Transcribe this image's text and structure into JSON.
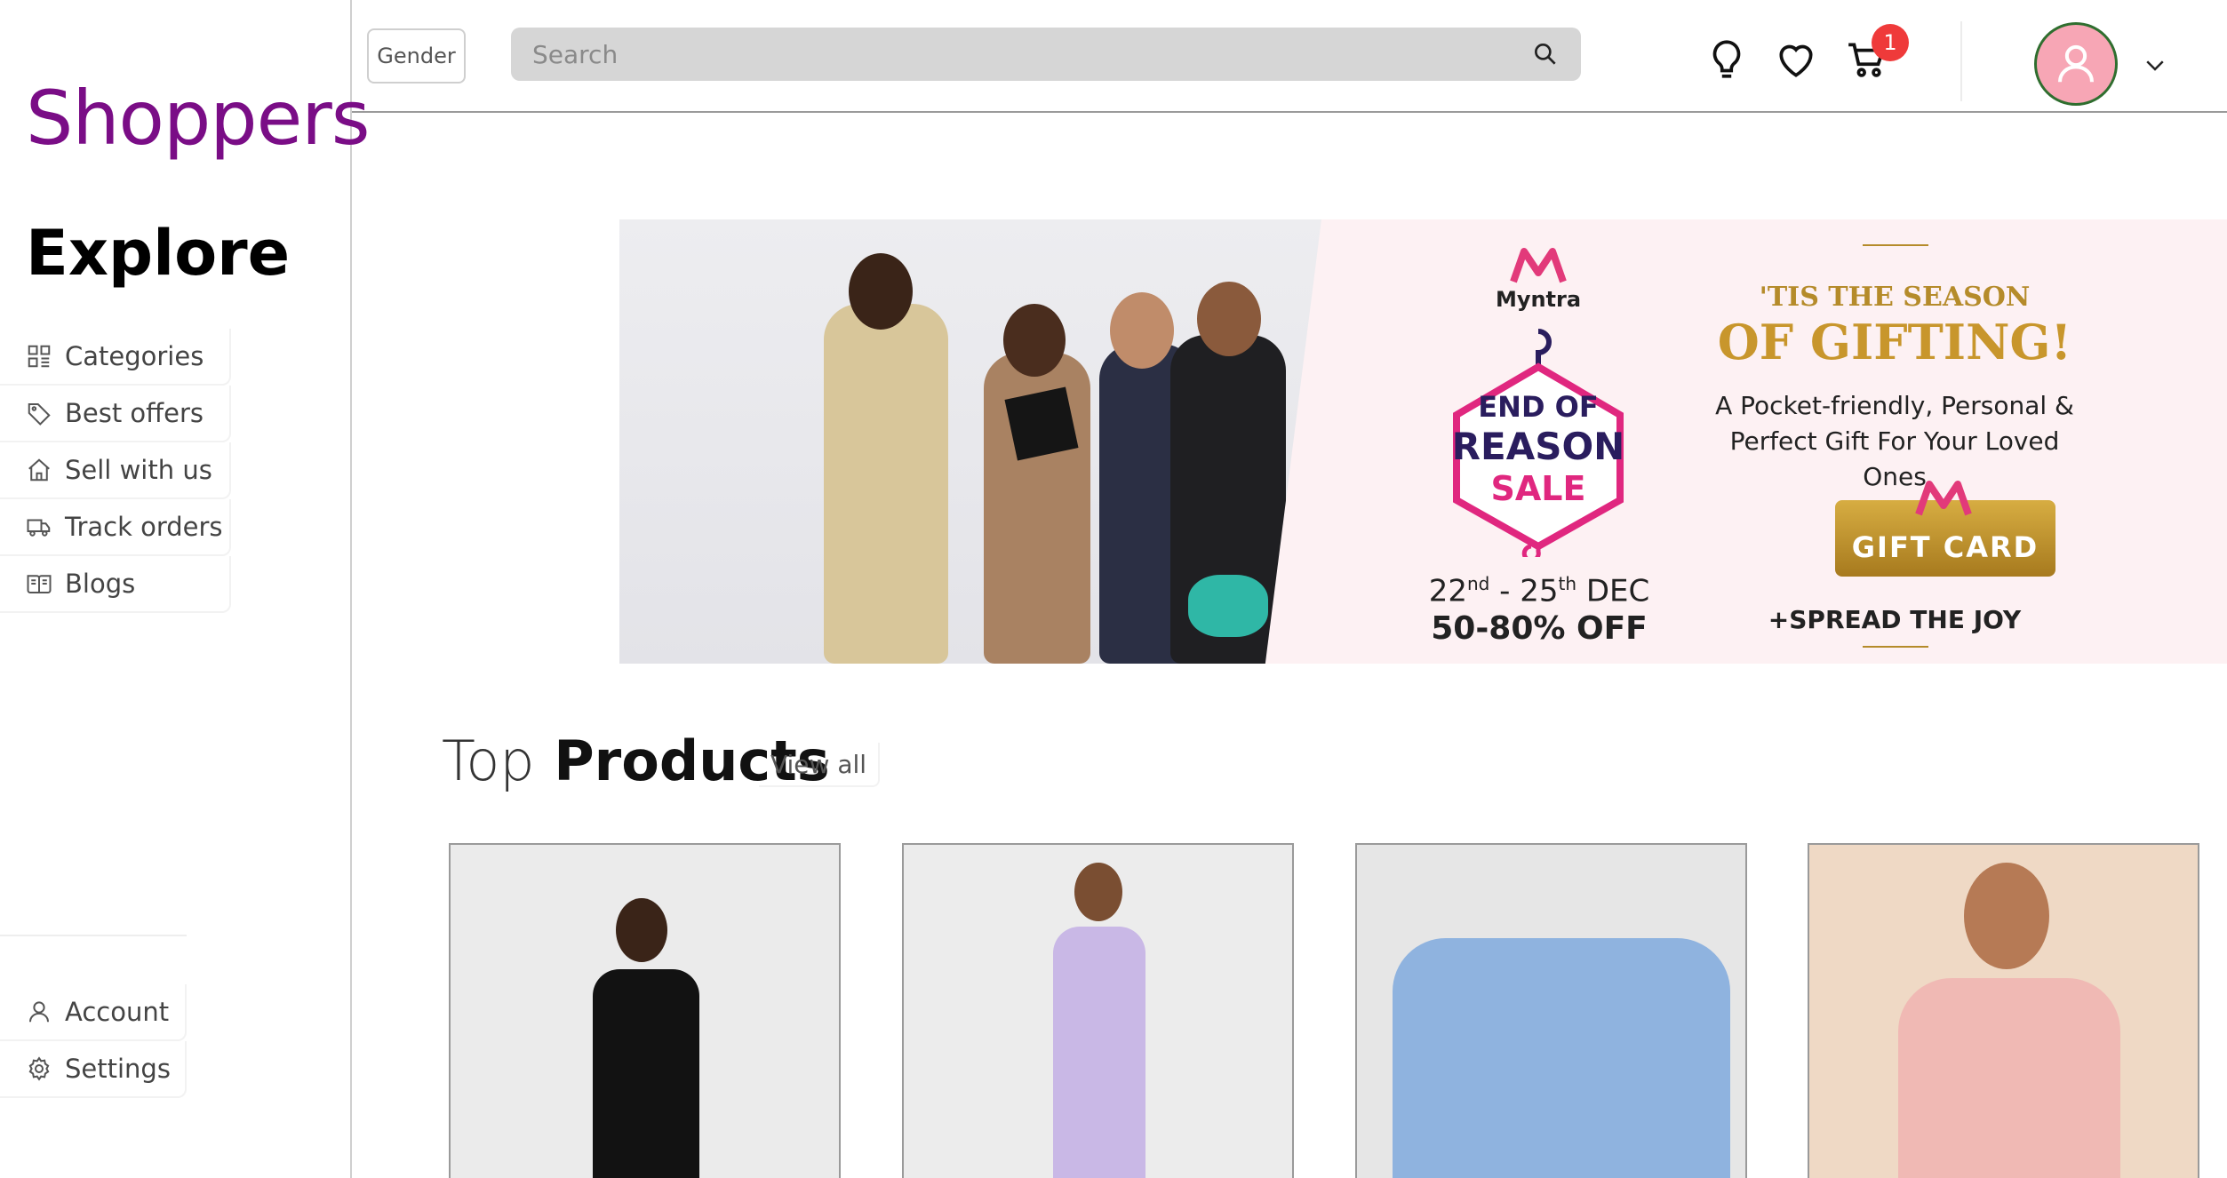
{
  "sidebar": {
    "brand": "Shoppers",
    "heading": "Explore",
    "items": [
      {
        "label": "Categories",
        "icon": "grid-icon"
      },
      {
        "label": "Best offers",
        "icon": "tag-icon"
      },
      {
        "label": "Sell with us",
        "icon": "home-icon"
      },
      {
        "label": "Track orders",
        "icon": "truck-icon"
      },
      {
        "label": "Blogs",
        "icon": "book-icon"
      }
    ],
    "bottom_items": [
      {
        "label": "Account",
        "icon": "user-icon"
      },
      {
        "label": "Settings",
        "icon": "gear-icon"
      }
    ]
  },
  "topbar": {
    "gender_label": "Gender",
    "search_placeholder": "Search",
    "cart_count": "1"
  },
  "banner": {
    "brand": "Myntra",
    "sale_line1": "END OF",
    "sale_line2": "REASON",
    "sale_line3": "SALE",
    "date_start": "22",
    "date_start_sup": "nd",
    "date_sep": " - 25",
    "date_end_sup": "th",
    "date_month": " DEC",
    "discount": "50-80% OFF",
    "tagline_small": "'TIS THE SEASON",
    "tagline_big": "OF GIFTING!",
    "desc_line1": "A Pocket-friendly, Personal &",
    "desc_line2": "Perfect Gift For Your Loved Ones",
    "giftcard_label": "GIFT CARD",
    "spread": "+SPREAD THE JOY"
  },
  "products_section": {
    "title_light": "Top",
    "title_bold": "Products",
    "view_all": "View all"
  },
  "colors": {
    "brand": "#7a0d86",
    "badge": "#ef3a3a",
    "avatar_bg": "#f7a6b5",
    "gold": "#c8962c"
  }
}
